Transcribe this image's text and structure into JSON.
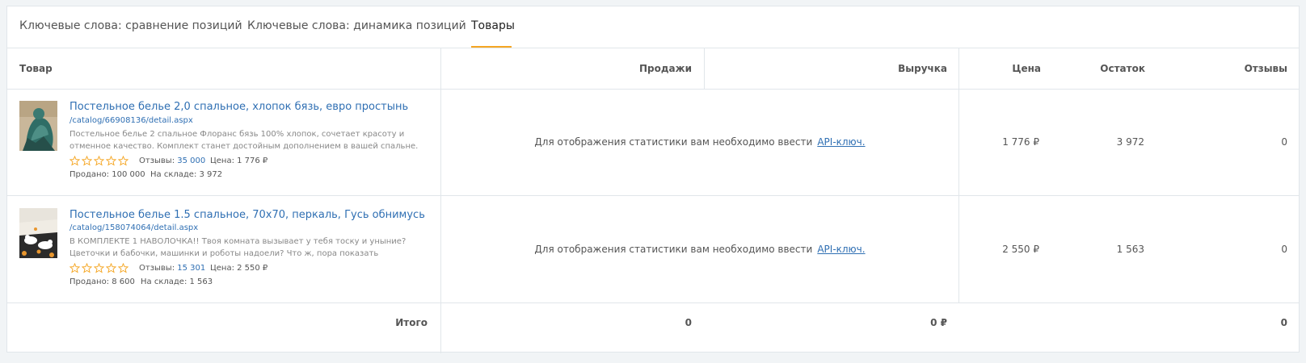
{
  "tabs": [
    {
      "label": "Ключевые слова: сравнение позиций",
      "active": false
    },
    {
      "label": "Ключевые слова: динамика позиций",
      "active": false
    },
    {
      "label": "Товары",
      "active": true
    }
  ],
  "columns": {
    "product": "Товар",
    "sales": "Продажи",
    "revenue": "Выручка",
    "price": "Цена",
    "stock": "Остаток",
    "reviews": "Отзывы"
  },
  "rows": [
    {
      "title": "Постельное белье 2,0 спальное, хлопок бязь, евро простынь",
      "link": "/catalog/66908136/detail.aspx",
      "description": "Постельное белье 2 спальное Флоранс бязь 100% хлопок, сочетает красоту и отменное качество. Комплект станет достойным дополнением в вашей спальне. Отлично",
      "rating": 5,
      "reviews_label": "Отзывы:",
      "reviews_count": "35 000",
      "price_label": "Цена: 1 776 ₽",
      "sold_label": "Продано: 100 000",
      "stock_label": "На складе: 3 972",
      "api_text": "Для отображения статистики вам необходимо ввести",
      "api_link": "API-ключ.",
      "price": "1 776 ₽",
      "stock": "3 972",
      "reviews": "0"
    },
    {
      "title": "Постельное белье 1.5 спальное, 70х70, перкаль, Гусь обнимусь",
      "link": "/catalog/158074064/detail.aspx",
      "description": "В КОМПЛЕКТЕ 1 НАВОЛОЧКА!! Твоя комната вызывает у тебя тоску и уныние? Цветочки и бабочки, машинки и роботы надоели? Что ж, пора показать родителям, что тебе это",
      "rating": 5,
      "reviews_label": "Отзывы:",
      "reviews_count": "15 301",
      "price_label": "Цена: 2 550 ₽",
      "sold_label": "Продано: 8 600",
      "stock_label": "На складе: 1 563",
      "api_text": "Для отображения статистики вам необходимо ввести",
      "api_link": "API-ключ.",
      "price": "2 550 ₽",
      "stock": "1 563",
      "reviews": "0"
    }
  ],
  "totals": {
    "label": "Итого",
    "sales": "0",
    "revenue": "0 ₽",
    "reviews": "0"
  },
  "colors": {
    "accent": "#f5a623",
    "link": "#2f6fb3",
    "border": "#e1e6ea"
  }
}
